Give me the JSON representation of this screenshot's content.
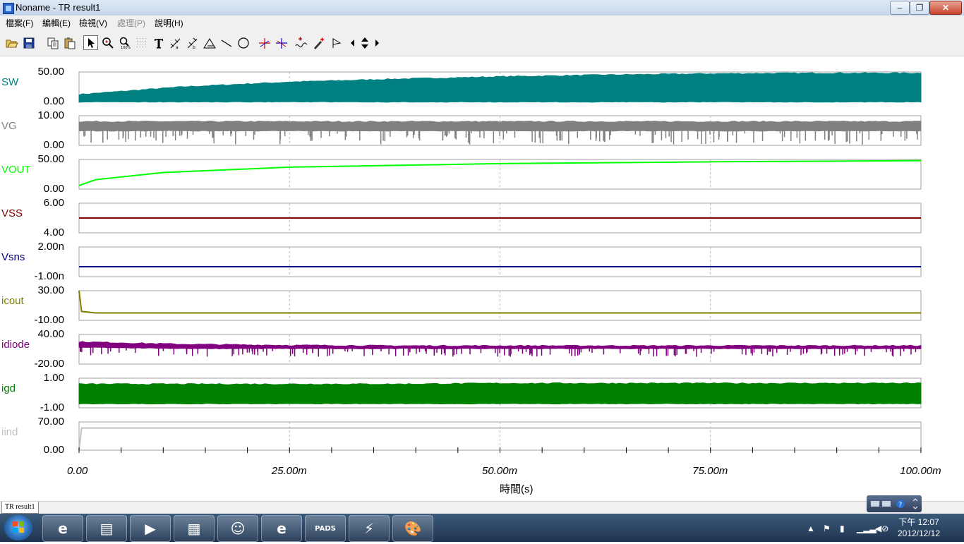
{
  "window": {
    "title": "Noname - TR result1",
    "minimize_glyph": "–",
    "maximize_glyph": "❐",
    "close_glyph": "✕"
  },
  "menu": [
    {
      "label": "檔案(F)",
      "enabled": true
    },
    {
      "label": "編輯(E)",
      "enabled": true
    },
    {
      "label": "檢視(V)",
      "enabled": true
    },
    {
      "label": "處理(P)",
      "enabled": false
    },
    {
      "label": "說明(H)",
      "enabled": true
    }
  ],
  "toolbar": [
    {
      "name": "open-icon"
    },
    {
      "name": "save-icon"
    },
    {
      "name": "copy-icon"
    },
    {
      "name": "paste-icon"
    },
    {
      "name": "pointer-icon",
      "pressed": true
    },
    {
      "name": "zoom-in-icon"
    },
    {
      "name": "zoom-100-icon"
    },
    {
      "name": "grid-icon"
    },
    {
      "name": "text-tool-icon"
    },
    {
      "name": "measure-icon"
    },
    {
      "name": "measure-alt-icon"
    },
    {
      "name": "slope-icon"
    },
    {
      "name": "line-tool-icon"
    },
    {
      "name": "circle-tool-icon"
    },
    {
      "name": "cursor-a-icon"
    },
    {
      "name": "cursor-b-icon"
    },
    {
      "name": "add-marker-icon"
    },
    {
      "name": "pen-marker-icon"
    },
    {
      "name": "flag-icon"
    },
    {
      "name": "arrow-left-icon"
    },
    {
      "name": "arrow-updown-icon"
    },
    {
      "name": "arrow-right-icon"
    }
  ],
  "colors": {
    "grid": "#b8b8b8",
    "frame": "#a0a0a0"
  },
  "chart_data": {
    "type": "line",
    "xlabel": "時間(s)",
    "x_unit": "s",
    "xlim": [
      0,
      0.1
    ],
    "x_ticks": [
      "0.00",
      "25.00m",
      "50.00m",
      "75.00m",
      "100.00m"
    ],
    "series": [
      {
        "name": "SW",
        "color": "#008080",
        "ylim": [
          0,
          50
        ],
        "y_ticks": [
          "50.00",
          "0.00"
        ],
        "style": "band",
        "envelope_top": [
          12,
          25,
          33,
          38,
          42,
          45,
          47,
          48,
          48
        ],
        "envelope_bottom": [
          0,
          0,
          0,
          0,
          0,
          0,
          0,
          0,
          0
        ]
      },
      {
        "name": "VG",
        "color": "#808080",
        "ylim": [
          0,
          10
        ],
        "y_ticks": [
          "10.00",
          "0.00"
        ],
        "style": "band",
        "envelope_top": [
          8,
          8,
          8,
          8,
          8,
          8,
          8,
          8,
          8
        ],
        "envelope_bottom": [
          5,
          5,
          5,
          5,
          5,
          5,
          5,
          5,
          5
        ]
      },
      {
        "name": "VOUT",
        "color": "#00ff00",
        "ylim": [
          0,
          50
        ],
        "y_ticks": [
          "50.00",
          "0.00"
        ],
        "style": "line",
        "x": [
          0,
          0.002,
          0.01,
          0.025,
          0.05,
          0.075,
          0.1
        ],
        "y": [
          6,
          16,
          28,
          37,
          43,
          46,
          48
        ]
      },
      {
        "name": "VSS",
        "color": "#800000",
        "ylim": [
          4,
          6
        ],
        "y_ticks": [
          "6.00",
          "4.00"
        ],
        "style": "line",
        "x": [
          0,
          0.1
        ],
        "y": [
          5,
          5
        ]
      },
      {
        "name": "Vsns",
        "color": "#000080",
        "ylim": [
          -1e-09,
          2e-09
        ],
        "y_ticks": [
          "2.00n",
          "-1.00n"
        ],
        "style": "line",
        "x": [
          0,
          0.1
        ],
        "y": [
          0,
          0
        ]
      },
      {
        "name": "icout",
        "color": "#808000",
        "ylim": [
          -10,
          30
        ],
        "y_ticks": [
          "30.00",
          "-10.00"
        ],
        "style": "line",
        "x": [
          0,
          0.0003,
          0.002,
          0.01,
          0.1
        ],
        "y": [
          30,
          2,
          0,
          0,
          0
        ]
      },
      {
        "name": "idiode",
        "color": "#800080",
        "ylim": [
          -20,
          40
        ],
        "y_ticks": [
          "40.00",
          "-20.00"
        ],
        "style": "band",
        "envelope_top": [
          25,
          20,
          18,
          17,
          17,
          17,
          17,
          17,
          17
        ],
        "envelope_bottom": [
          15,
          12,
          12,
          12,
          12,
          12,
          12,
          12,
          12
        ]
      },
      {
        "name": "igd",
        "color": "#008000",
        "ylim": [
          -1,
          1
        ],
        "y_ticks": [
          "1.00",
          "-1.00"
        ],
        "style": "band",
        "envelope_top": [
          0.6,
          0.6,
          0.6,
          0.6,
          0.65,
          0.65,
          0.65,
          0.65,
          0.65
        ],
        "envelope_bottom": [
          -0.7,
          -0.7,
          -0.7,
          -0.7,
          -0.7,
          -0.7,
          -0.7,
          -0.7,
          -0.7
        ]
      },
      {
        "name": "iind",
        "color": "#c0c0c0",
        "ylim": [
          0,
          70
        ],
        "y_ticks": [
          "70.00",
          "0.00"
        ],
        "style": "line",
        "x": [
          0,
          0.0003,
          0.1
        ],
        "y": [
          0,
          55,
          55
        ]
      }
    ]
  },
  "sheet_tab": "TR result1",
  "taskbar": {
    "clock_time": "下午 12:07",
    "clock_date": "2012/12/12",
    "apps": [
      {
        "name": "ie-taskbar-button",
        "glyph": "e"
      },
      {
        "name": "explorer-taskbar-button",
        "glyph": "▤"
      },
      {
        "name": "media-player-taskbar-button",
        "glyph": "▶"
      },
      {
        "name": "app-taskbar-button-4",
        "glyph": "▦"
      },
      {
        "name": "messenger-taskbar-button",
        "glyph": "☺"
      },
      {
        "name": "ie-taskbar-button-2",
        "glyph": "e"
      },
      {
        "name": "pads-taskbar-button",
        "glyph": "PADS"
      },
      {
        "name": "tina-taskbar-button",
        "glyph": "⚡"
      },
      {
        "name": "paint-taskbar-button",
        "glyph": "🎨"
      }
    ]
  }
}
